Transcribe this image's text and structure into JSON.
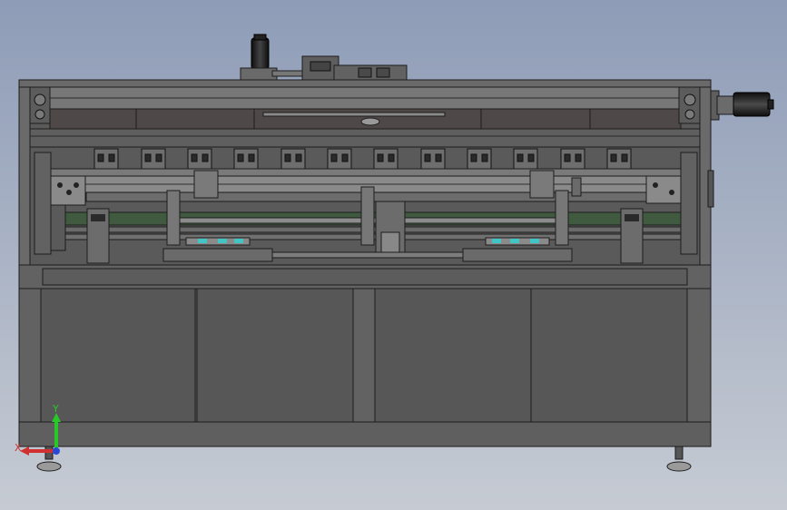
{
  "colors": {
    "background_top": "#8f9db8",
    "background_bottom": "#c5cad2",
    "frame": "#5a5a5a",
    "frame_dark": "#3e3e3e",
    "panel": "#585858",
    "line": "#1c1c1c",
    "accent_cyan": "#42c4c4",
    "green_strip": "#3f5a3f",
    "motor_black": "#1a1a1a",
    "axis_x": "#d03030",
    "axis_y": "#28c828",
    "axis_z": "#2848d8"
  },
  "icons": {
    "triad": "coordinate-triad-icon",
    "motor_top": "servo-motor-icon",
    "motor_right": "servo-motor-icon"
  },
  "triad": {
    "x_label": "X",
    "y_label": "Y"
  }
}
